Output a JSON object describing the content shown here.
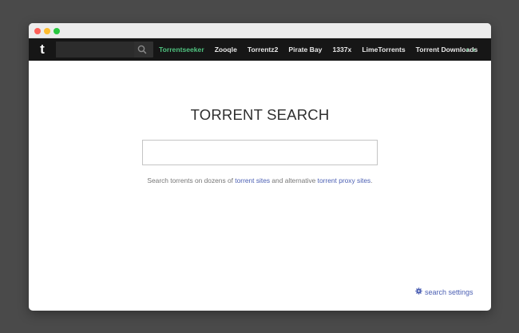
{
  "navbar": {
    "logo": "t",
    "search_placeholder": "",
    "links": [
      {
        "label": "Torrentseeker",
        "active": true
      },
      {
        "label": "Zooqle"
      },
      {
        "label": "Torrentz2"
      },
      {
        "label": "Pirate Bay"
      },
      {
        "label": "1337x"
      },
      {
        "label": "LimeTorrents"
      },
      {
        "label": "Torrent Downloads"
      }
    ],
    "prev_arrow": "‹",
    "next_arrow": "›"
  },
  "main": {
    "title": "TORRENT SEARCH",
    "search_value": "",
    "subtext_prefix": "Search torrents on dozens of ",
    "link_torrent_sites": "torrent sites",
    "subtext_middle": " and alternative ",
    "link_proxy_sites": "torrent proxy sites",
    "subtext_suffix": "."
  },
  "footer": {
    "settings_label": "search settings",
    "settings_icon": "gear-icon"
  },
  "colors": {
    "accent_green": "#4fc27f",
    "link_blue": "#4b5fb3",
    "navbar_bg": "#161616"
  }
}
